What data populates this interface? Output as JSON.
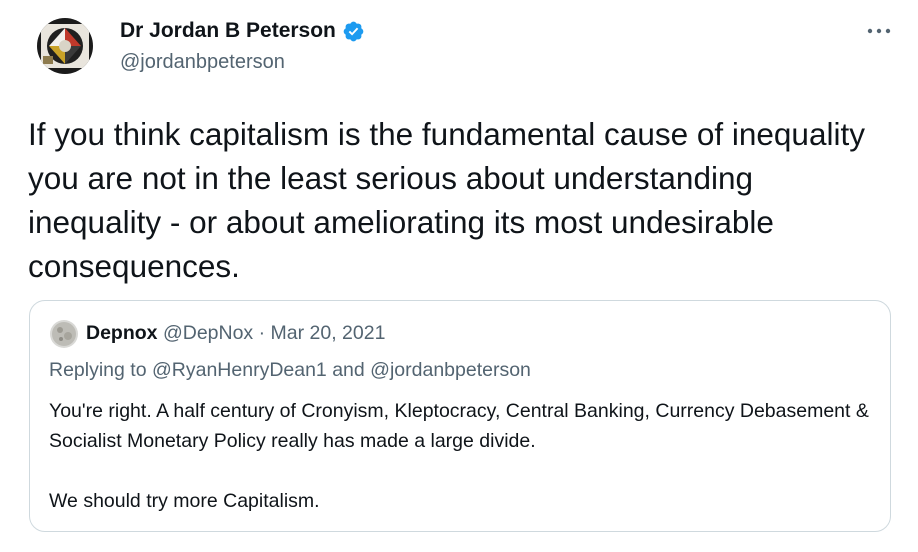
{
  "tweet": {
    "author": {
      "name": "Dr Jordan B Peterson",
      "handle": "@jordanbpeterson",
      "verified": true,
      "avatar_icon": "profile-avatar-icon"
    },
    "more_icon": "more-horizontal-icon",
    "text": "If you think capitalism is the fundamental cause of inequality you are not in the least serious about understanding inequality - or about ameliorating its most undesirable consequences."
  },
  "quoted_tweet": {
    "author": {
      "name": "Depnox",
      "handle": "@DepNox",
      "avatar_icon": "moon-avatar-icon"
    },
    "separator": "·",
    "date": "Mar 20, 2021",
    "reply_prefix": "Replying to",
    "reply_user_1": "@RyanHenryDean1",
    "reply_and": "and",
    "reply_user_2": "@jordanbpeterson",
    "paragraphs": [
      "You're right. A half century of Cronyism, Kleptocracy, Central Banking, Currency Debasement & Socialist Monetary Policy really has made a large divide.",
      "We should try more Capitalism."
    ]
  },
  "colors": {
    "text_primary": "#0f1419",
    "text_secondary": "#536471",
    "verified_blue": "#1d9bf0",
    "border": "#cfd9de"
  }
}
